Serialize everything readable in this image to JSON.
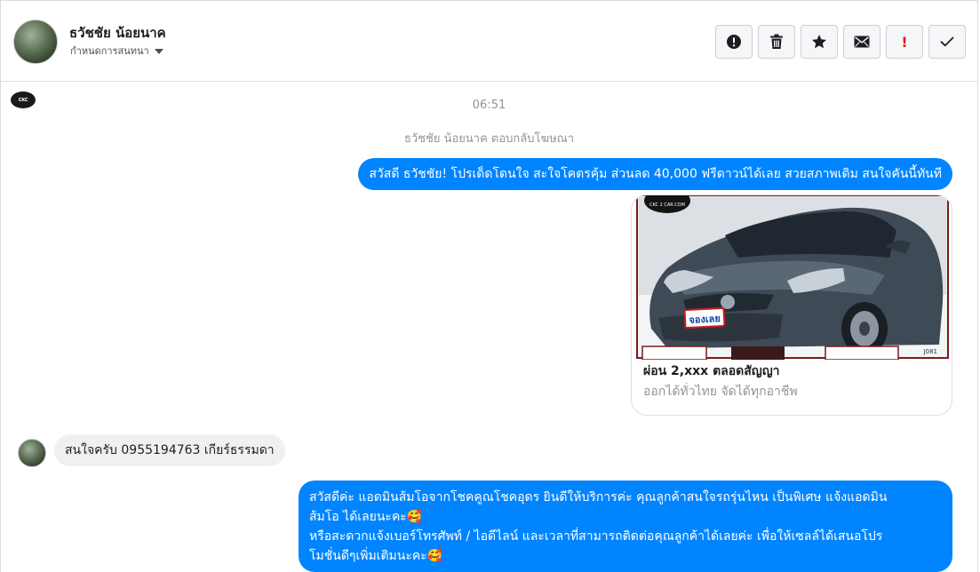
{
  "header": {
    "contact_name": "ธวัชชัย น้อยนาค",
    "subtitle": "กำหนดการสนทนา",
    "toolbar": [
      {
        "name": "mark-spam-button",
        "icon": "alert-circle-icon"
      },
      {
        "name": "delete-button",
        "icon": "trash-icon"
      },
      {
        "name": "star-button",
        "icon": "star-icon"
      },
      {
        "name": "mark-unread-button",
        "icon": "envelope-icon"
      },
      {
        "name": "follow-up-button",
        "icon": "exclamation-icon",
        "label": "!"
      },
      {
        "name": "mark-done-button",
        "icon": "check-icon"
      }
    ]
  },
  "chat": {
    "timestamp": "06:51",
    "ad_reply_notice": "ธวัชชัย น้อยนาค ตอบกลับโฆษณา",
    "messages": [
      {
        "from": "page",
        "text": "สวัสดี ธวัชชัย! โปรเด็ดโดนใจ สะใจโคตรคุ้ม ส่วนลด 40,000 ฟรีดาวน์ได้เลย สวยสภาพเดิม สนใจคันนี้ทันที"
      },
      {
        "from": "page",
        "type": "ad-card",
        "title": "ผ่อน 2,xxx ตลอดสัญญา",
        "subtitle": "ออกได้ทั่วไทย จัดได้ทุกอาชีพ",
        "image_text": {
          "logo": "CKC 2 CAR.COM",
          "stamp": "จองเลย",
          "code": "J081"
        }
      },
      {
        "from": "user",
        "text": "สนใจครับ 0955194763  เกียร์ธรรมดา"
      },
      {
        "from": "page",
        "lines": [
          "สวัสดีค่ะ แอดมินส้มโอจากโชคคูณโชคอุดร ยินดีให้บริการค่ะ   คุณลูกค้าสนใจรถรุ่นไหน เป็นพิเศษ แจ้งแอดมิน",
          "ส้มโอ ได้เลยนะคะ🥰",
          "หรือสะดวกแจ้งเบอร์โทรศัพท์ / ไอดีไลน์ และเวลาที่สามารถติดต่อคุณลูกค้าได้เลยค่ะ เพื่อให้เซลล์ได้เสนอโปร",
          "โมชั่นดีๆเพิ่มเติมนะคะ🥰"
        ]
      }
    ]
  },
  "colors": {
    "outgoing_bubble": "#0084ff",
    "incoming_bubble": "#f1f0f0",
    "alert_red": "#e02020"
  }
}
